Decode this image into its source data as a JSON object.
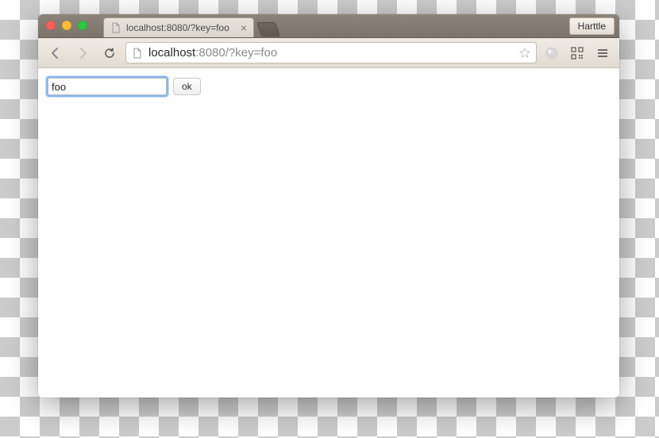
{
  "window": {
    "user_label": "Harttle"
  },
  "tab": {
    "title": "localhost:8080/?key=foo"
  },
  "address": {
    "host": "localhost",
    "rest": ":8080/?key=foo"
  },
  "form": {
    "input_value": "foo",
    "submit_label": "ok"
  }
}
